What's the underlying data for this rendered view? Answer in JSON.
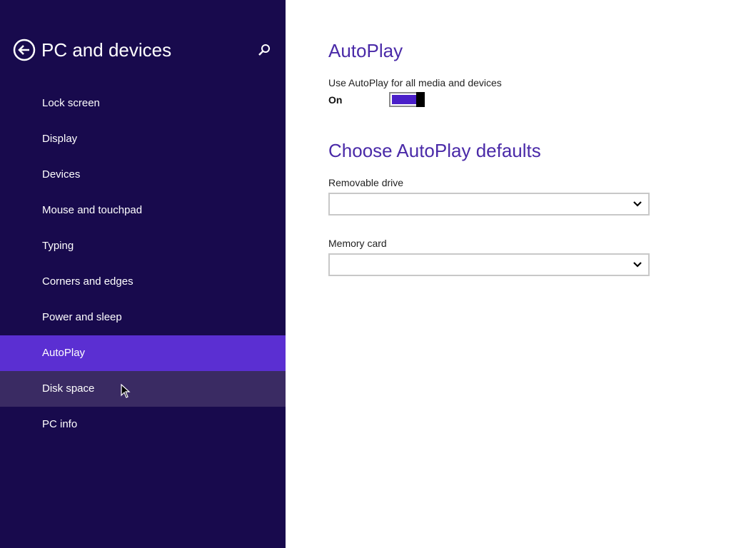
{
  "sidebar": {
    "title": "PC and devices",
    "back_icon": "back-arrow-circle-icon",
    "search_icon": "search-icon",
    "items": [
      {
        "label": "Lock screen"
      },
      {
        "label": "Display"
      },
      {
        "label": "Devices"
      },
      {
        "label": "Mouse and touchpad"
      },
      {
        "label": "Typing"
      },
      {
        "label": "Corners and edges"
      },
      {
        "label": "Power and sleep"
      },
      {
        "label": "AutoPlay"
      },
      {
        "label": "Disk space"
      },
      {
        "label": "PC info"
      }
    ],
    "selected_item": "AutoPlay",
    "hovered_item": "Disk space"
  },
  "main": {
    "autoplay_heading": "AutoPlay",
    "toggle_caption": "Use AutoPlay for all media and devices",
    "toggle_state": "On",
    "defaults_heading": "Choose AutoPlay defaults",
    "removable_drive": {
      "label": "Removable drive",
      "value": ""
    },
    "memory_card": {
      "label": "Memory card",
      "value": ""
    }
  },
  "colors": {
    "sidebar_bg": "#180a4d",
    "selected_bg": "#5b2fd2",
    "hover_bg": "#3a2b63",
    "heading": "#4a2aa8",
    "toggle_fill": "#4a1fc9"
  }
}
